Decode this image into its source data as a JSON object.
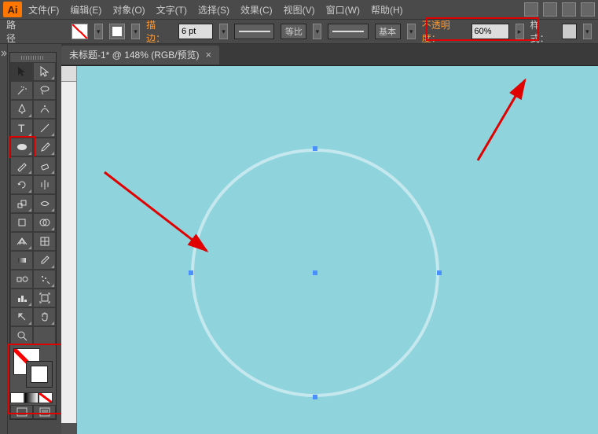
{
  "app": {
    "logo": "Ai"
  },
  "menu": {
    "file": "文件(F)",
    "edit": "编辑(E)",
    "object": "对象(O)",
    "type": "文字(T)",
    "select": "选择(S)",
    "effect": "效果(C)",
    "view": "视图(V)",
    "window": "窗口(W)",
    "help": "帮助(H)"
  },
  "control": {
    "kind_label": "路径",
    "stroke_label": "描边：",
    "stroke_value": "6 pt",
    "brush_profile_label": "等比",
    "brush_def_label": "基本",
    "opacity_label": "不透明度：",
    "opacity_value": "60%",
    "style_label": "样式："
  },
  "tab": {
    "title": "未标题-1* @ 148% (RGB/预览)",
    "close": "×"
  },
  "tools": {
    "selection": "selection",
    "direct": "direct-selection",
    "wand": "magic-wand",
    "lasso": "lasso",
    "pen": "pen",
    "curve": "curvature",
    "type": "type",
    "line": "line-segment",
    "ellipse": "ellipse",
    "brush": "paintbrush",
    "pencil": "pencil",
    "eraser": "eraser",
    "rotate": "rotate",
    "reflect": "reflect",
    "scale": "scale",
    "width": "width",
    "free": "free-transform",
    "shbuild": "shape-builder",
    "persp": "perspective-grid",
    "mesh": "mesh",
    "gradient": "gradient",
    "eyedrop": "eyedropper",
    "measure": "measure",
    "blend": "blend",
    "symbol": "symbol-sprayer",
    "graph": "column-graph",
    "artb": "artboard",
    "slice": "slice",
    "hand": "hand",
    "zoom": "zoom"
  }
}
